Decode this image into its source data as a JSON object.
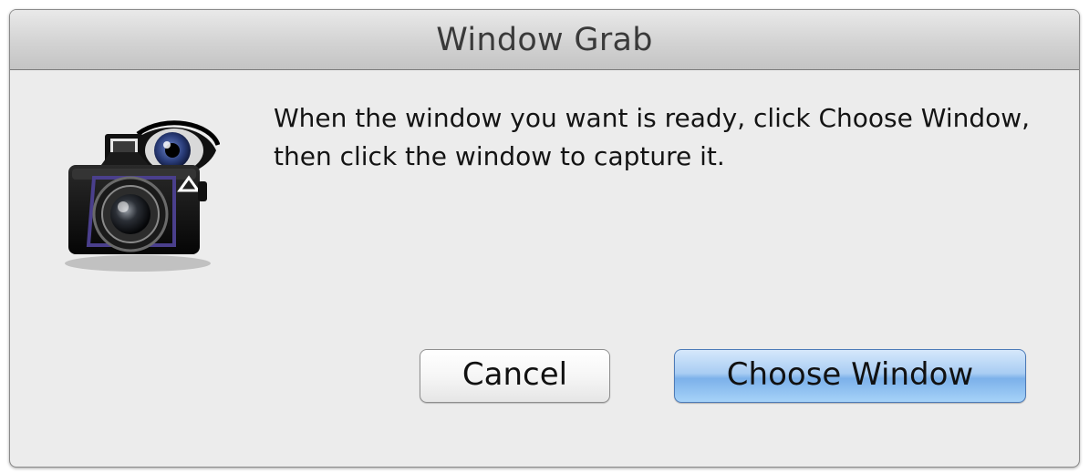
{
  "window": {
    "title": "Window Grab"
  },
  "dialog": {
    "icon": "camera-with-eye-icon",
    "message": "When the window you want is ready, click Choose Window, then click the window to capture it."
  },
  "buttons": {
    "cancel_label": "Cancel",
    "choose_window_label": "Choose Window"
  },
  "colors": {
    "default_button": "#8fc0ef",
    "window_background": "#ececec",
    "titlebar": "#d3d3d3"
  }
}
